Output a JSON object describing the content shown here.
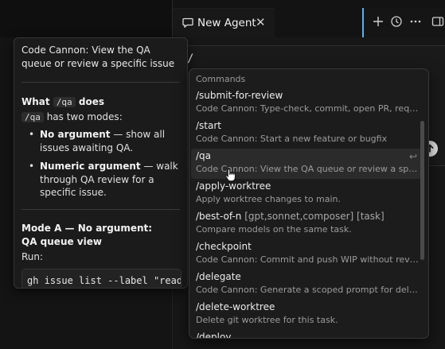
{
  "tab": {
    "label": "New Agent",
    "icon": "chat-bubble-icon",
    "close_icon": "close-icon"
  },
  "toolbar": {
    "icons": [
      "plus-icon",
      "history-icon",
      "more-icon",
      "panel-icon"
    ]
  },
  "composer": {
    "value": "/"
  },
  "tooltip": {
    "description": "Code Cannon: View the QA queue or review a specific issue",
    "what_prefix": "What",
    "what_code": "/qa",
    "what_suffix": "does",
    "modes_code": "/qa",
    "modes_text": "has two modes:",
    "bullets": [
      {
        "bold": "No argument",
        "text": " — show all issues awaiting QA."
      },
      {
        "bold": "Numeric argument",
        "text": " — walk through QA review for a specific issue."
      }
    ],
    "mode_a_heading": "Mode A — No argument: QA queue view",
    "run_label": "Run:",
    "code": "gh issue list --label \"ready-for-qa\""
  },
  "commands": {
    "header": "Commands",
    "items": [
      {
        "name": "/submit-for-review",
        "args": "",
        "desc": "Code Cannon: Type-check, commit, open PR, request review"
      },
      {
        "name": "/start",
        "args": "",
        "desc": "Code Cannon: Start a new feature or bugfix"
      },
      {
        "name": "/qa",
        "args": "",
        "desc": "Code Cannon: View the QA queue or review a specific issue",
        "selected": true
      },
      {
        "name": "/apply-worktree",
        "args": "",
        "desc": "Apply worktree changes to main."
      },
      {
        "name": "/best-of-n",
        "args": "[gpt,sonnet,composer] [task]",
        "desc": "Compare models on the same task."
      },
      {
        "name": "/checkpoint",
        "args": "",
        "desc": "Code Cannon: Commit and push WIP without review"
      },
      {
        "name": "/delegate",
        "args": "",
        "desc": "Code Cannon: Generate a scoped prompt for delegation"
      },
      {
        "name": "/delete-worktree",
        "args": "",
        "desc": "Delete git worktree for this task."
      },
      {
        "name": "/deploy",
        "args": "",
        "desc": ""
      }
    ]
  }
}
